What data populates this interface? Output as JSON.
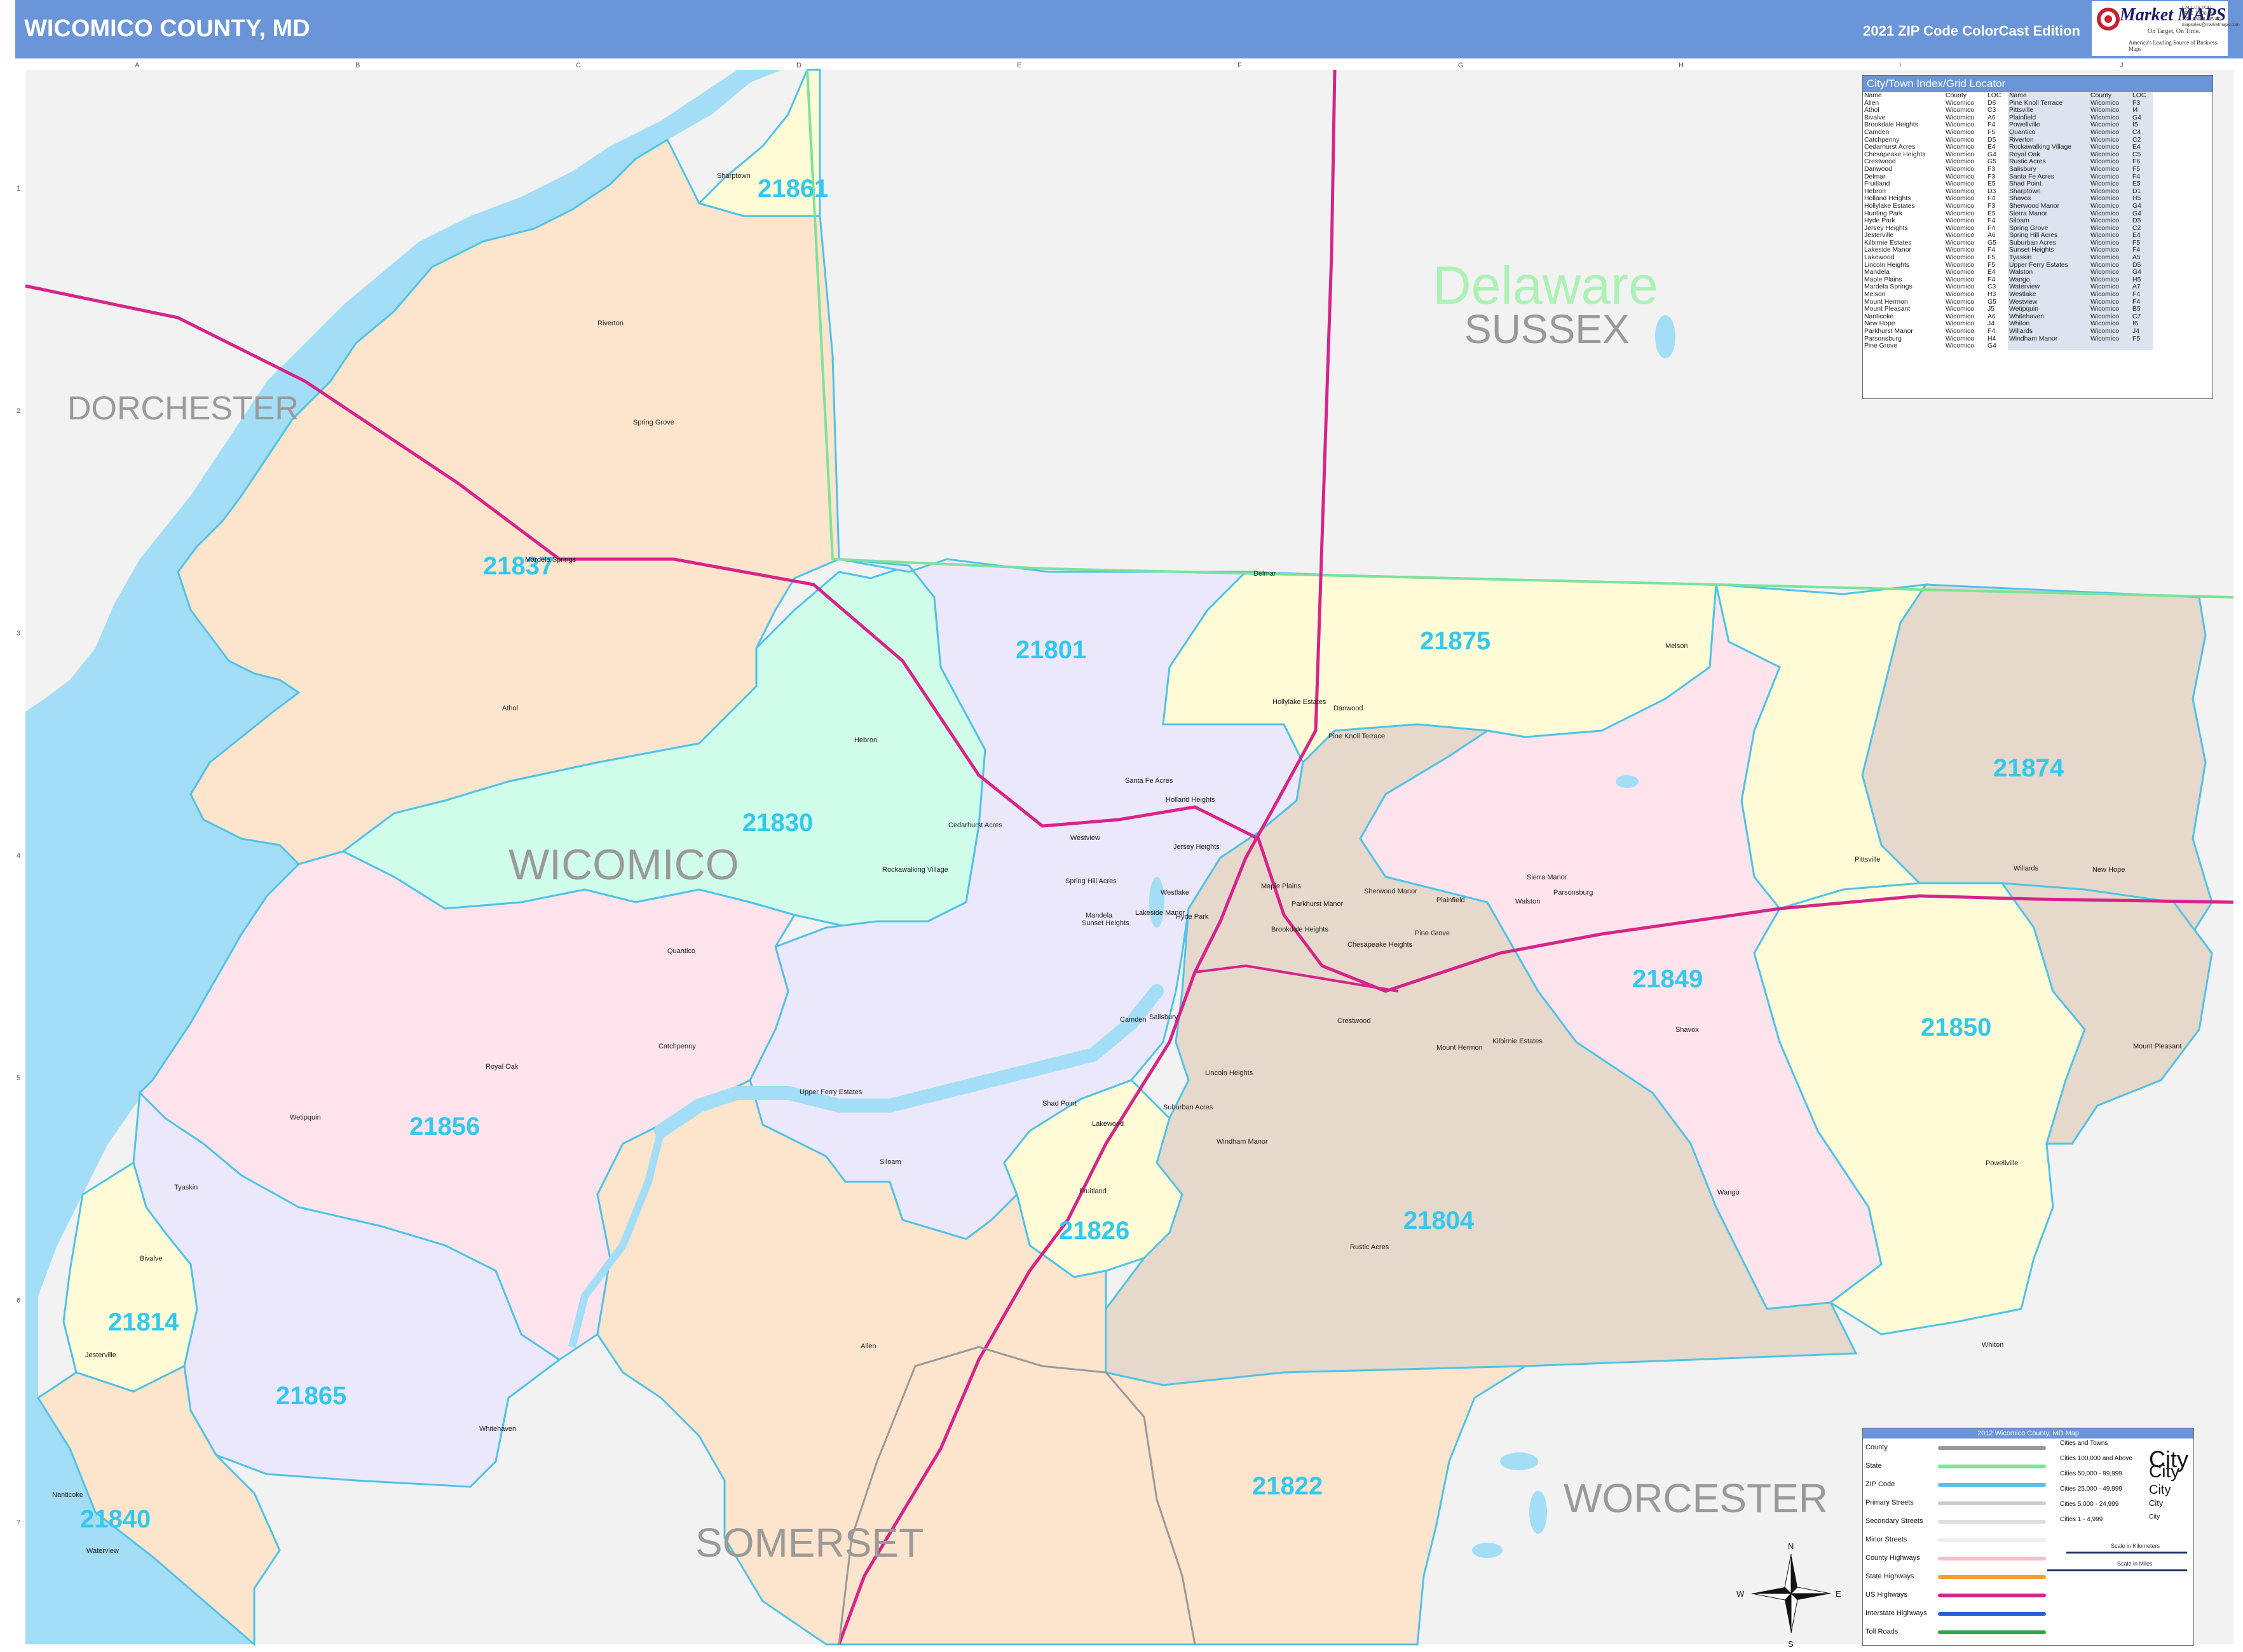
{
  "header": {
    "title": "WICOMICO COUNTY, MD",
    "edition": "2021 ZIP Code ColorCast Edition",
    "logo": {
      "brand": "Market MAPS",
      "tagline": "On Target, On Time.",
      "subtagline": "America's Leading Source of Business Maps",
      "phone": "CALL US TOLL FREE 1-800-458-2721 EMAIL US AT: mapsales@marketmaps.com"
    }
  },
  "colors": {
    "header_bg": "#6a95d8",
    "water": "#a3ddf6",
    "outside": "#f2f2f2",
    "zip_label": "#33c8ee",
    "state_line": "#7be39a",
    "zip_line": "#4fc3e8",
    "us_highway": "#d6248a",
    "orange_zone": "#fde4cc",
    "purple_zone": "#ece8fb",
    "green_zone": "#cffde9",
    "yellow_zone": "#fffbd6",
    "pink_zone": "#fde4ec",
    "brown_zone": "#e6d8cb"
  },
  "map": {
    "grid_columns": [
      "A",
      "B",
      "C",
      "D",
      "E",
      "F",
      "G",
      "H",
      "I",
      "J"
    ],
    "grid_rows": [
      "1",
      "2",
      "3",
      "4",
      "5",
      "6",
      "7"
    ],
    "county_labels": [
      "DORCHESTER",
      "SUSSEX",
      "WICOMICO",
      "SOMERSET",
      "WORCESTER"
    ],
    "state_label": "Delaware",
    "zip_codes": [
      "21861",
      "21837",
      "21801",
      "21875",
      "21874",
      "21830",
      "21849",
      "21850",
      "21856",
      "21826",
      "21804",
      "21814",
      "21865",
      "21840",
      "21822"
    ],
    "towns": [
      "Sharptown",
      "Riverton",
      "Spring Grove",
      "Mardela Springs",
      "Athol",
      "Hebron",
      "Rockawalking Village",
      "Cedarhurst Acres",
      "Santa Fe Acres",
      "Holland Heights",
      "Jersey Heights",
      "Westview",
      "Spring Hill Acres",
      "Mandela",
      "Westlake",
      "Lakeside Manor",
      "Sunset Heights",
      "Hyde Park",
      "Camden",
      "Salisbury",
      "Delmar",
      "Hollylake Estates",
      "Danwood",
      "Pine Knoll Terrace",
      "Melson",
      "Maple Plains",
      "Parkhurst Manor",
      "Sherwood Manor",
      "Brookdale Heights",
      "Chesapeake Heights",
      "Pine Grove",
      "Plainfield",
      "Sierra Manor",
      "Walston",
      "Parsonsburg",
      "Crestwood",
      "Mount Hermon",
      "Kilbirnie Estates",
      "Shavox",
      "Pittsville",
      "Willards",
      "New Hope",
      "Mount Pleasant",
      "Quantico",
      "Catchpenny",
      "Royal Oak",
      "Whitehaven",
      "Upper Ferry Estates",
      "Shad Point",
      "Siloam",
      "Lincoln Heights",
      "Suburban Acres",
      "Lakewood",
      "Windham Manor",
      "Fruitland",
      "Rustic Acres",
      "Wango",
      "Powellville",
      "Whiton",
      "Allen",
      "Tyaskin",
      "Wetipquin",
      "Bivalve",
      "Jesterville",
      "Nanticoke",
      "Waterview"
    ]
  },
  "index": {
    "title": "City/Town Index/Grid Locator",
    "headers": [
      "Name",
      "County",
      "LOC",
      "Name",
      "County",
      "LOC"
    ],
    "rows": [
      [
        "Allen",
        "Wicomico",
        "D6",
        "Pine Knoll Terrace",
        "Wicomico",
        "F3"
      ],
      [
        "Athol",
        "Wicomico",
        "C3",
        "Pittsville",
        "Wicomico",
        "I4"
      ],
      [
        "Bivalve",
        "Wicomico",
        "A6",
        "Plainfield",
        "Wicomico",
        "G4"
      ],
      [
        "Brookdale Heights",
        "Wicomico",
        "F4",
        "Powellville",
        "Wicomico",
        "I5"
      ],
      [
        "Camden",
        "Wicomico",
        "F5",
        "Quantico",
        "Wicomico",
        "C4"
      ],
      [
        "Catchpenny",
        "Wicomico",
        "D5",
        "Riverton",
        "Wicomico",
        "C2"
      ],
      [
        "Cedarhurst Acres",
        "Wicomico",
        "E4",
        "Rockawalking Village",
        "Wicomico",
        "E4"
      ],
      [
        "Chesapeake Heights",
        "Wicomico",
        "G4",
        "Royal Oak",
        "Wicomico",
        "C5"
      ],
      [
        "Crestwood",
        "Wicomico",
        "G5",
        "Rustic Acres",
        "Wicomico",
        "F6"
      ],
      [
        "Danwood",
        "Wicomico",
        "F3",
        "Salisbury",
        "Wicomico",
        "F5"
      ],
      [
        "Delmar",
        "Wicomico",
        "F3",
        "Santa Fe Acres",
        "Wicomico",
        "F4"
      ],
      [
        "Fruitland",
        "Wicomico",
        "E5",
        "Shad Point",
        "Wicomico",
        "E5"
      ],
      [
        "Hebron",
        "Wicomico",
        "D3",
        "Sharptown",
        "Wicomico",
        "D1"
      ],
      [
        "Holland Heights",
        "Wicomico",
        "F4",
        "Shavox",
        "Wicomico",
        "H5"
      ],
      [
        "Hollylake Estates",
        "Wicomico",
        "F3",
        "Sherwood Manor",
        "Wicomico",
        "G4"
      ],
      [
        "Hunting Park",
        "Wicomico",
        "E5",
        "Sierra Manor",
        "Wicomico",
        "G4"
      ],
      [
        "Hyde Park",
        "Wicomico",
        "F4",
        "Siloam",
        "Wicomico",
        "D5"
      ],
      [
        "Jersey Heights",
        "Wicomico",
        "F4",
        "Spring Grove",
        "Wicomico",
        "C2"
      ],
      [
        "Jesterville",
        "Wicomico",
        "A6",
        "Spring Hill Acres",
        "Wicomico",
        "E4"
      ],
      [
        "Kilbirnie Estates",
        "Wicomico",
        "G5",
        "Suburban Acres",
        "Wicomico",
        "F5"
      ],
      [
        "Lakeside Manor",
        "Wicomico",
        "F4",
        "Sunset Heights",
        "Wicomico",
        "F4"
      ],
      [
        "Lakewood",
        "Wicomico",
        "F5",
        "Tyaskin",
        "Wicomico",
        "A5"
      ],
      [
        "Lincoln Heights",
        "Wicomico",
        "F5",
        "Upper Ferry Estates",
        "Wicomico",
        "D5"
      ],
      [
        "Mandela",
        "Wicomico",
        "E4",
        "Walston",
        "Wicomico",
        "G4"
      ],
      [
        "Maple Plains",
        "Wicomico",
        "F4",
        "Wango",
        "Wicomico",
        "H5"
      ],
      [
        "Mardela Springs",
        "Wicomico",
        "C3",
        "Waterview",
        "Wicomico",
        "A7"
      ],
      [
        "Melson",
        "Wicomico",
        "H3",
        "Westlake",
        "Wicomico",
        "F4"
      ],
      [
        "Mount Hermon",
        "Wicomico",
        "G5",
        "Westview",
        "Wicomico",
        "F4"
      ],
      [
        "Mount Pleasant",
        "Wicomico",
        "J5",
        "Wetipquin",
        "Wicomico",
        "B5"
      ],
      [
        "Nanticoke",
        "Wicomico",
        "A6",
        "Whitehaven",
        "Wicomico",
        "C7"
      ],
      [
        "New Hope",
        "Wicomico",
        "J4",
        "Whiton",
        "Wicomico",
        "I6"
      ],
      [
        "Parkhurst Manor",
        "Wicomico",
        "F4",
        "Willards",
        "Wicomico",
        "J4"
      ],
      [
        "Parsonsburg",
        "Wicomico",
        "H4",
        "Windham Manor",
        "Wicomico",
        "F5"
      ],
      [
        "Pine Grove",
        "Wicomico",
        "G4",
        "",
        "",
        ""
      ]
    ]
  },
  "legend": {
    "title": "2012 Wicomico County, MD Map",
    "items": [
      "County",
      "State",
      "ZIP Code",
      "Primary Streets",
      "Secondary Streets",
      "Minor Streets",
      "County Highways",
      "State Highways",
      "US Highways",
      "Interstate Highways",
      "Toll Roads"
    ],
    "cities": [
      {
        "label": "Cities and Towns",
        "sample": ""
      },
      {
        "label": "Cities 100,000 and Above",
        "sample": "City"
      },
      {
        "label": "Cities 50,000 - 99,999",
        "sample": "City"
      },
      {
        "label": "Cities 25,000 - 49,999",
        "sample": "City"
      },
      {
        "label": "Cities 5,000 - 24,999",
        "sample": "City"
      },
      {
        "label": "Cities 1 - 4,999",
        "sample": "City"
      }
    ],
    "scale_km": "Scale in Kilometers",
    "scale_mi": "Scale in Miles"
  },
  "compass": {
    "n": "N",
    "s": "S",
    "e": "E",
    "w": "W"
  }
}
